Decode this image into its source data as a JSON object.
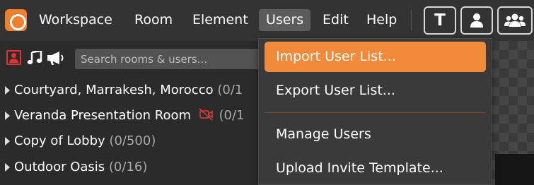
{
  "menubar": {
    "logo_icon": "app-logo-icon",
    "items": [
      {
        "label": "Workspace"
      },
      {
        "label": "Room"
      },
      {
        "label": "Element"
      },
      {
        "label": "Users",
        "active": true
      },
      {
        "label": "Edit"
      },
      {
        "label": "Help"
      }
    ],
    "tools": [
      {
        "icon": "text-tool-icon",
        "glyph": "T"
      },
      {
        "icon": "user-icon"
      },
      {
        "icon": "users-group-icon"
      }
    ]
  },
  "room_panel": {
    "filter_icons": [
      "user-filter-icon",
      "music-note-icon",
      "megaphone-icon"
    ],
    "search": {
      "placeholder": "Search rooms & users...",
      "value": ""
    },
    "rooms": [
      {
        "name": "Courtyard, Marrakesh, Morocco",
        "count": "(0/1"
      },
      {
        "name": "Veranda Presentation Room",
        "count": "(0/1",
        "icon": "camera-off-icon"
      },
      {
        "name": "Copy of Lobby",
        "count": "(0/500)"
      },
      {
        "name": "Outdoor Oasis",
        "count": "(0/16)"
      }
    ]
  },
  "users_menu": {
    "items": [
      {
        "label": "Import User List...",
        "highlighted": true
      },
      {
        "label": "Export User List..."
      },
      {
        "label": "Manage Users"
      },
      {
        "label": "Upload Invite Template..."
      }
    ]
  },
  "colors": {
    "accent": "#f28a3c",
    "logo": "#f07f2e",
    "menubar": "#333333",
    "panel": "#2b2b2b",
    "danger_icon": "#e03434"
  }
}
